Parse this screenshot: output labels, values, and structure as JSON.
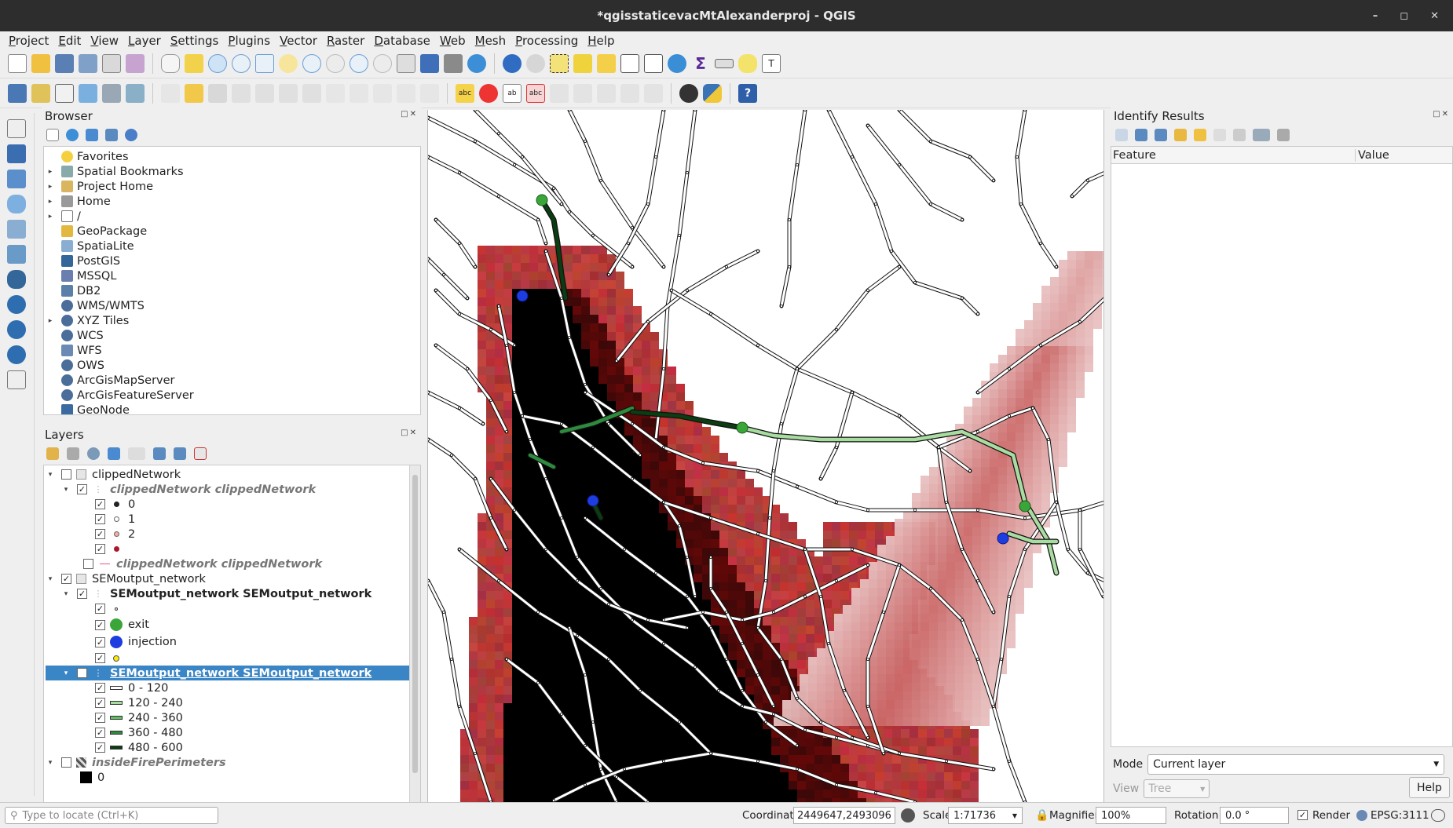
{
  "window": {
    "title": "*qgisstaticevacMtAlexanderproj - QGIS"
  },
  "menu": [
    "Project",
    "Edit",
    "View",
    "Layer",
    "Settings",
    "Plugins",
    "Vector",
    "Raster",
    "Database",
    "Web",
    "Mesh",
    "Processing",
    "Help"
  ],
  "browser": {
    "title": "Browser",
    "items": [
      {
        "label": "Favorites",
        "icon": "star-icon",
        "expand": false
      },
      {
        "label": "Spatial Bookmarks",
        "icon": "bookmark-icon",
        "expand": true
      },
      {
        "label": "Project Home",
        "icon": "folder-project-icon",
        "expand": true
      },
      {
        "label": "Home",
        "icon": "home-icon",
        "expand": true
      },
      {
        "label": "/",
        "icon": "folder-icon",
        "expand": true
      },
      {
        "label": "GeoPackage",
        "icon": "geopackage-icon",
        "expand": false
      },
      {
        "label": "SpatiaLite",
        "icon": "spatialite-icon",
        "expand": false
      },
      {
        "label": "PostGIS",
        "icon": "postgis-icon",
        "expand": false
      },
      {
        "label": "MSSQL",
        "icon": "mssql-icon",
        "expand": false
      },
      {
        "label": "DB2",
        "icon": "db2-icon",
        "expand": false
      },
      {
        "label": "WMS/WMTS",
        "icon": "globe-icon",
        "expand": false
      },
      {
        "label": "XYZ Tiles",
        "icon": "globe-icon",
        "expand": true
      },
      {
        "label": "WCS",
        "icon": "globe-icon",
        "expand": false
      },
      {
        "label": "WFS",
        "icon": "wfs-icon",
        "expand": false
      },
      {
        "label": "OWS",
        "icon": "globe-icon",
        "expand": false
      },
      {
        "label": "ArcGisMapServer",
        "icon": "globe-icon",
        "expand": false
      },
      {
        "label": "ArcGisFeatureServer",
        "icon": "globe-icon",
        "expand": false
      },
      {
        "label": "GeoNode",
        "icon": "geonode-icon",
        "expand": false
      }
    ]
  },
  "layers": {
    "title": "Layers",
    "clipped_group": "clippedNetwork",
    "clipped_points": "clippedNetwork clippedNetwork",
    "clipped_cats": [
      "0",
      "1",
      "2",
      ""
    ],
    "clipped_lines": "clippedNetwork clippedNetwork",
    "sem_group": "SEMoutput_network",
    "sem_points": "SEMoutput_network SEMoutput_network",
    "sem_cats": [
      "",
      "exit",
      "injection",
      ""
    ],
    "sem_lines": "SEMoutput_network SEMoutput_network",
    "sem_ranges": [
      "0 - 120",
      "120 - 240",
      "240 - 360",
      "360 - 480",
      "480 - 600"
    ],
    "fire_layer": "insideFirePerimeters",
    "fire_cat": "0"
  },
  "colors": {
    "range": [
      "#ffffff",
      "#a8dca0",
      "#5fbf5f",
      "#2e8b3e",
      "#0b3d12"
    ],
    "exit": "#3aa63a",
    "injection": "#1e3de0",
    "yellow": "#ffea00",
    "fire": "#8b1a1a"
  },
  "identify": {
    "title": "Identify Results",
    "col_feature": "Feature",
    "col_value": "Value",
    "mode_label": "Mode",
    "mode_value": "Current layer",
    "view_label": "View",
    "view_value": "Tree",
    "help": "Help"
  },
  "status": {
    "locate_placeholder": "Type to locate (Ctrl+K)",
    "coordinate_label": "Coordinate",
    "coordinate_value": "2449647,2493096",
    "scale_label": "Scale",
    "scale_value": "1:71736",
    "magnifier_label": "Magnifier",
    "magnifier_value": "100%",
    "rotation_label": "Rotation",
    "rotation_value": "0.0 °",
    "render_label": "Render",
    "epsg": "EPSG:3111"
  }
}
